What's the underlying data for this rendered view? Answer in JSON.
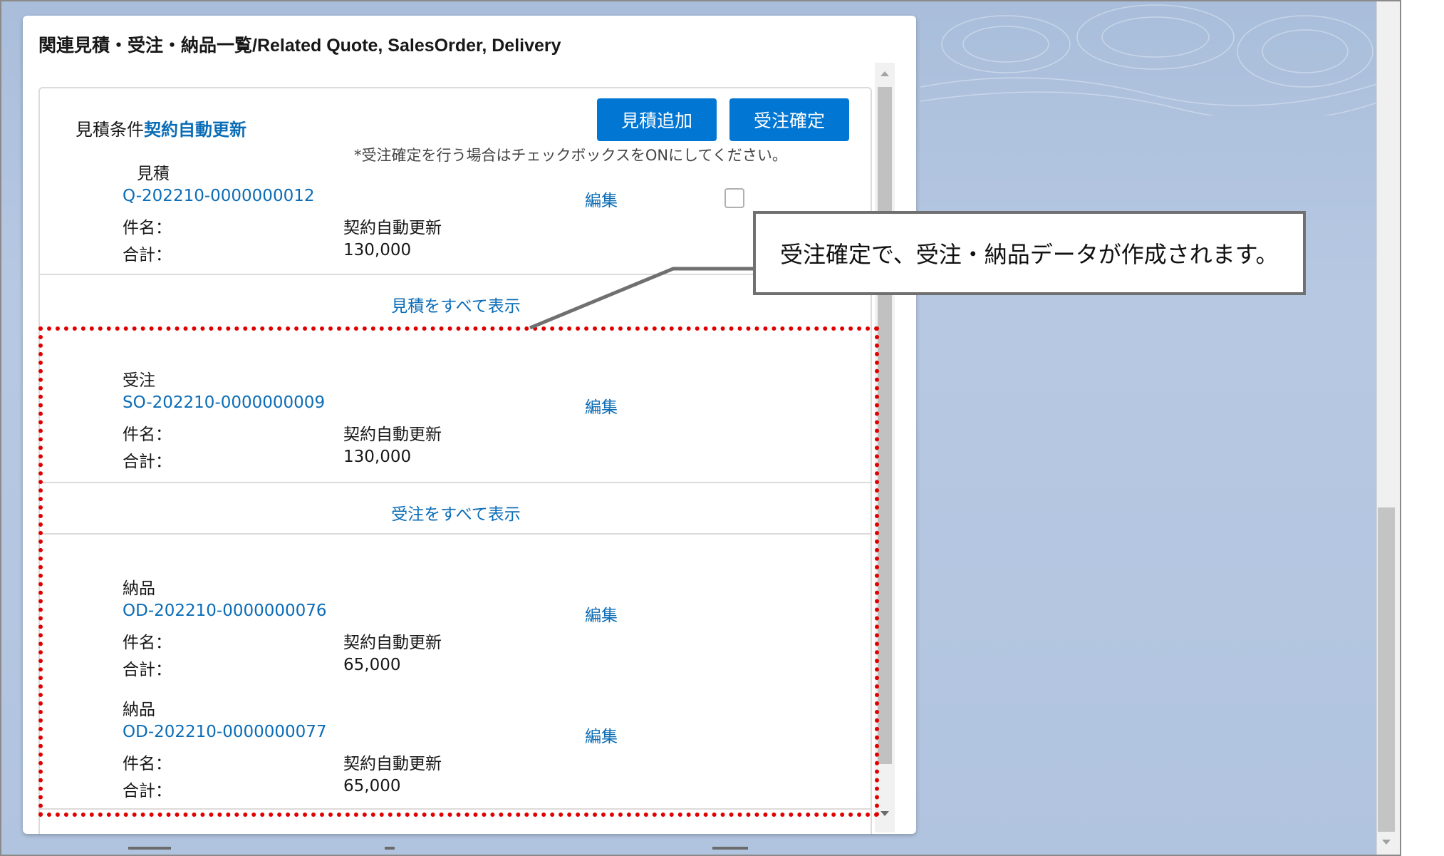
{
  "modal": {
    "title": "関連見積・受注・納品一覧/Related Quote, SalesOrder, Delivery"
  },
  "quote_section": {
    "condition_label": "見積条件",
    "condition_link": "契約自動更新",
    "add_quote_button": "見積追加",
    "confirm_order_button": "受注確定",
    "note": "*受注確定を行う場合はチェックボックスをONにしてください。",
    "record": {
      "type_label": "見積",
      "number": "Q-202210-0000000012",
      "edit_label": "編集",
      "subject_label": "件名：",
      "subject_value": "契約自動更新",
      "total_label": "合計：",
      "total_value": "130,000",
      "checked": false
    },
    "show_all": "見積をすべて表示"
  },
  "order_section": {
    "record": {
      "type_label": "受注",
      "number": "SO-202210-0000000009",
      "edit_label": "編集",
      "subject_label": "件名：",
      "subject_value": "契約自動更新",
      "total_label": "合計：",
      "total_value": "130,000"
    },
    "show_all": "受注をすべて表示"
  },
  "delivery_section": {
    "records": [
      {
        "type_label": "納品",
        "number": "OD-202210-0000000076",
        "edit_label": "編集",
        "subject_label": "件名：",
        "subject_value": "契約自動更新",
        "total_label": "合計：",
        "total_value": "65,000"
      },
      {
        "type_label": "納品",
        "number": "OD-202210-0000000077",
        "edit_label": "編集",
        "subject_label": "件名：",
        "subject_value": "契約自動更新",
        "total_label": "合計：",
        "total_value": "65,000"
      }
    ]
  },
  "callout": {
    "text": "受注確定で、受注・納品データが作成されます。"
  },
  "colors": {
    "primary_button": "#0176d3",
    "link": "#0b6cb6",
    "highlight_border": "#e00000",
    "background_blue": "#b1c4df"
  }
}
